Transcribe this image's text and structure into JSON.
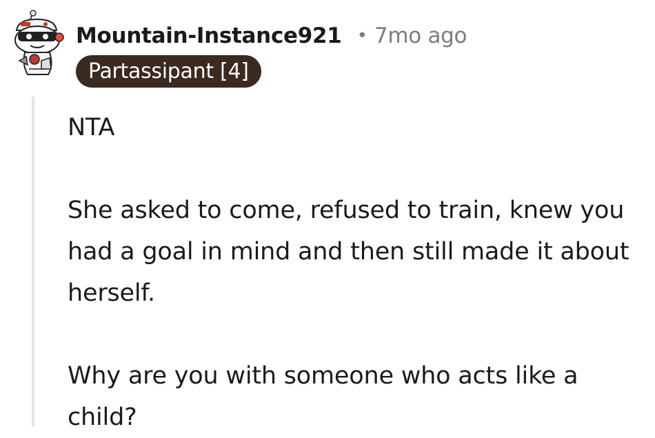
{
  "comment": {
    "author": "Mountain-Instance921",
    "separator": "•",
    "time_ago": "7mo ago",
    "flair": "Partassipant [4]",
    "avatar_icon": "snoo-avatar-icon",
    "paragraphs": [
      "NTA",
      "She asked to come, refused to train, knew you had a goal in mind and then still made it about herself.",
      "Why are you with someone who acts like a child?"
    ]
  },
  "colors": {
    "flair_background": "#3b2a20",
    "flair_text": "#ffffff",
    "meta_text": "#7c7c7c",
    "thread_line": "#e4e4e4"
  }
}
